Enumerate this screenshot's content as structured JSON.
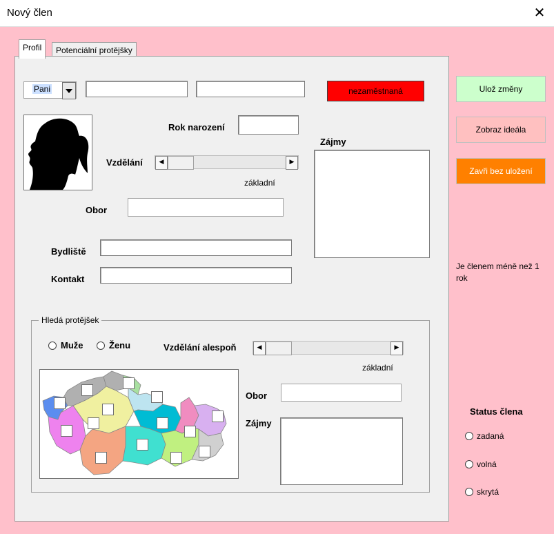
{
  "window": {
    "title": "Nový člen",
    "close_glyph": "✕"
  },
  "tabs": [
    {
      "label": "Profil"
    },
    {
      "label": "Potenciální protějšky"
    }
  ],
  "profile": {
    "salutation": "Pani",
    "first_name": "",
    "last_name": "",
    "status_badge": "nezaměstnaná",
    "birth_year_label": "Rok narození",
    "birth_year_value": "",
    "education_label": "Vzdělání",
    "education_value": "základní",
    "field_label": "Obor",
    "field_value": "",
    "interests_label": "Zájmy",
    "interests_value": "",
    "residence_label": "Bydliště",
    "residence_value": "",
    "contact_label": "Kontakt",
    "contact_value": ""
  },
  "seeking": {
    "legend": "Hledá protějšek",
    "option_men": "Muže",
    "option_women": "Ženu",
    "min_education_label": "Vzdělání alespoň",
    "min_education_value": "základní",
    "field_label": "Obor",
    "field_value": "",
    "interests_label": "Zájmy",
    "interests_value": ""
  },
  "side": {
    "save_button": "Ulož změny",
    "show_ideal_button": "Zobraz ideála",
    "close_no_save_button": "Zavři bez uložení",
    "membership_note": "Je členem méně než 1 rok",
    "status_title": "Status člena",
    "status_options": [
      "zadaná",
      "volná",
      "skrytá"
    ]
  },
  "colors": {
    "background": "#ffc0cb",
    "badge": "#ff0000",
    "save": "#ccffcc",
    "show_ideal": "#ffc0c0",
    "close_no_save": "#ff8000"
  },
  "map": {
    "regions": [
      "#5b8def",
      "#b0b0b0",
      "#a8e0a0",
      "#f0f0a0",
      "#bde4f0",
      "#ee82ee",
      "#00ced1",
      "#dda0dd",
      "#f4a582",
      "#40e0d0",
      "#c0f080",
      "#d0d0d0",
      "#d8b0f0",
      "#f08cc0"
    ]
  }
}
